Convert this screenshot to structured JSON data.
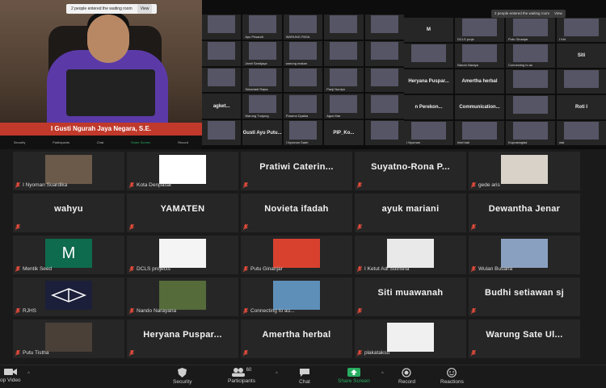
{
  "speaker": {
    "name": "I Gusti Ngurah Jaya Negara, S.E.",
    "notice": "2 people entered the waiting room",
    "notice_btn": "View",
    "mini_toolbar": [
      "Security",
      "Participants",
      "Chat",
      "Share Screen",
      "Record"
    ]
  },
  "mid_tiles": [
    {
      "label": ""
    },
    {
      "label": "Ayu Prisandi",
      "big": ""
    },
    {
      "label": "WARUNG PASA"
    },
    {
      "label": ""
    },
    {
      "label": ""
    },
    {
      "label": ""
    },
    {
      "label": "Jamil Sandjaya"
    },
    {
      "label": "warung makan"
    },
    {
      "label": ""
    },
    {
      "label": ""
    },
    {
      "label": ""
    },
    {
      "label": "Sekartadi Rajsa"
    },
    {
      "label": ""
    },
    {
      "label": "Panji Nurdyn"
    },
    {
      "label": ""
    },
    {
      "label": "",
      "big": "agket..."
    },
    {
      "label": "Warung Tunjung"
    },
    {
      "label": "Paramo Dyakia"
    },
    {
      "label": "Agus Mar"
    },
    {
      "label": ""
    },
    {
      "label": "",
      "big": ""
    },
    {
      "label": "",
      "big": "Gusti Ayu Putu..."
    },
    {
      "label": "I Nyoman Sadri"
    },
    {
      "label": "",
      "big": "PIP_Ko..."
    },
    {
      "label": ""
    }
  ],
  "right_notice": "2 people entered the waiting room",
  "right_notice_btn": "View",
  "right_tiles": [
    {
      "big": "M",
      "label": ""
    },
    {
      "label": "DCLS proje"
    },
    {
      "label": "Putu Ginanjar"
    },
    {
      "label": "I Ket"
    },
    {
      "label": ""
    },
    {
      "label": "Nando Naraya"
    },
    {
      "label": "Connecting to au"
    },
    {
      "big": "Siti"
    },
    {
      "big": "Heryana Puspar...",
      "label": ""
    },
    {
      "big": "Amertha herbal"
    },
    {
      "label": ""
    },
    {
      "big": ""
    },
    {
      "big": "n Perekon..."
    },
    {
      "big": "Communication..."
    },
    {
      "label": ""
    },
    {
      "big": "Roti I"
    },
    {
      "label": "I Nyoman"
    },
    {
      "label": "Intel bali"
    },
    {
      "label": "Koprasinglad"
    },
    {
      "label": "wat"
    }
  ],
  "grid": [
    {
      "label": "I Nyoman Suardika",
      "type": "photo",
      "color": "#6b5a4a"
    },
    {
      "label": "Kota Denpasar",
      "type": "photo",
      "color": "#ffffff"
    },
    {
      "big": "Pratiwi  Caterin..."
    },
    {
      "big": "Suyatno-Rona  P..."
    },
    {
      "label": "gede aris",
      "type": "photo",
      "color": "#d8d2c8"
    },
    {
      "big": "wahyu"
    },
    {
      "big": "YAMATEN"
    },
    {
      "big": "Novieta ifadah"
    },
    {
      "big": "ayuk mariani"
    },
    {
      "big": "Dewantha Jenar"
    },
    {
      "label": "Mentik Seed",
      "type": "M",
      "color": "#0e6b4d"
    },
    {
      "label": "DCLS projects",
      "type": "photo",
      "color": "#f4f4f4"
    },
    {
      "label": "Putu Ginanjar",
      "type": "photo",
      "color": "#d8412e"
    },
    {
      "label": "I Ketut Adi Sutrisna",
      "type": "photo",
      "color": "#e9e9e9"
    },
    {
      "label": "Wulan Busana",
      "type": "photo",
      "color": "#8aa0c0"
    },
    {
      "label": "RJHS",
      "type": "logo",
      "color": "#1b1f3a"
    },
    {
      "label": "Nando Narayana",
      "type": "photo",
      "color": "#556b3a"
    },
    {
      "label": "Connecting to au...",
      "type": "photo",
      "color": "#5d8fb8"
    },
    {
      "big": "Siti  muawanah"
    },
    {
      "big": "Budhi  setiawan  sj"
    },
    {
      "label": "Putu Tistha",
      "type": "photo",
      "color": "#4a4038"
    },
    {
      "big": "Heryana  Puspar..."
    },
    {
      "big": "Amertha  herbal"
    },
    {
      "label": "plakataksu",
      "type": "photo",
      "color": "#f0f0f0"
    },
    {
      "big": "Warung  Sate  Ul..."
    }
  ],
  "toolbar": {
    "stop_video": "op Video",
    "security": "Security",
    "participants": "Participants",
    "participants_count": "60",
    "chat": "Chat",
    "share": "Share Screen",
    "record": "Record",
    "reactions": "Reactions"
  },
  "colors": {
    "share_green": "#27ae60",
    "mic_red": "#e74c3c",
    "tile_bg": "#262626"
  }
}
